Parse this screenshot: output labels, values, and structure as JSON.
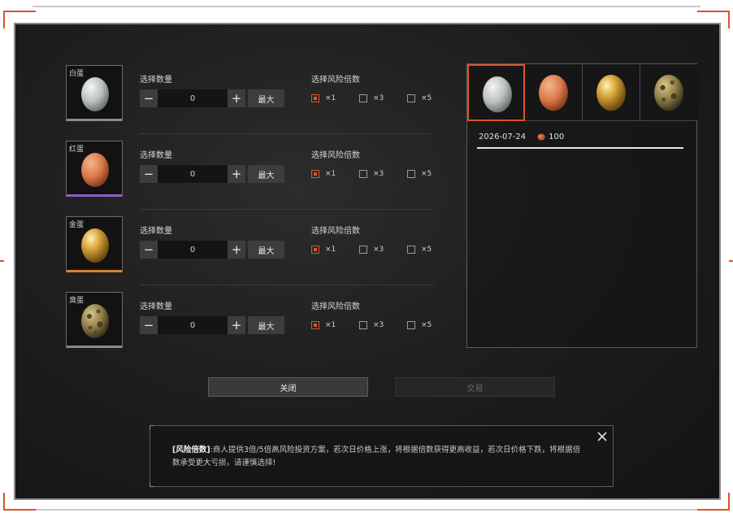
{
  "eggs": [
    {
      "name": "白蛋",
      "bar_color": "#8a8a8a"
    },
    {
      "name": "红蛋",
      "bar_color": "#8e5cc7"
    },
    {
      "name": "金蛋",
      "bar_color": "#d9822b"
    },
    {
      "name": "臭蛋",
      "bar_color": "#8a8a8a"
    }
  ],
  "rows": [
    {
      "qty_label": "选择数量",
      "qty_value": "0",
      "minus": "−",
      "plus": "+",
      "max_label": "最大",
      "risk_label": "选择风险倍数",
      "options": [
        "×1",
        "×3",
        "×5"
      ],
      "selected": "×1"
    },
    {
      "qty_label": "选择数量",
      "qty_value": "0",
      "minus": "−",
      "plus": "+",
      "max_label": "最大",
      "risk_label": "选择风险倍数",
      "options": [
        "×1",
        "×3",
        "×5"
      ],
      "selected": "×1"
    },
    {
      "qty_label": "选择数量",
      "qty_value": "0",
      "minus": "−",
      "plus": "+",
      "max_label": "最大",
      "risk_label": "选择风险倍数",
      "options": [
        "×1",
        "×3",
        "×5"
      ],
      "selected": "×1"
    },
    {
      "qty_label": "选择数量",
      "qty_value": "0",
      "minus": "−",
      "plus": "+",
      "max_label": "最大",
      "risk_label": "选择风险倍数",
      "options": [
        "×1",
        "×3",
        "×5"
      ],
      "selected": "×1"
    }
  ],
  "price_panel": {
    "date": "2026-07-24",
    "price": "100",
    "selected_egg": 0
  },
  "buttons": {
    "close": "关闭",
    "trade": "交易"
  },
  "tip": {
    "highlight": "[风险倍数]",
    "body": ":商人提供3倍/5倍高风险投资方案，若次日价格上涨，将根据倍数获得更高收益，若次日价格下跌，将根据倍数承受更大亏损，请谨慎选择!"
  },
  "colors": {
    "accent": "#d9542b",
    "panel": "#1c1c1c"
  }
}
